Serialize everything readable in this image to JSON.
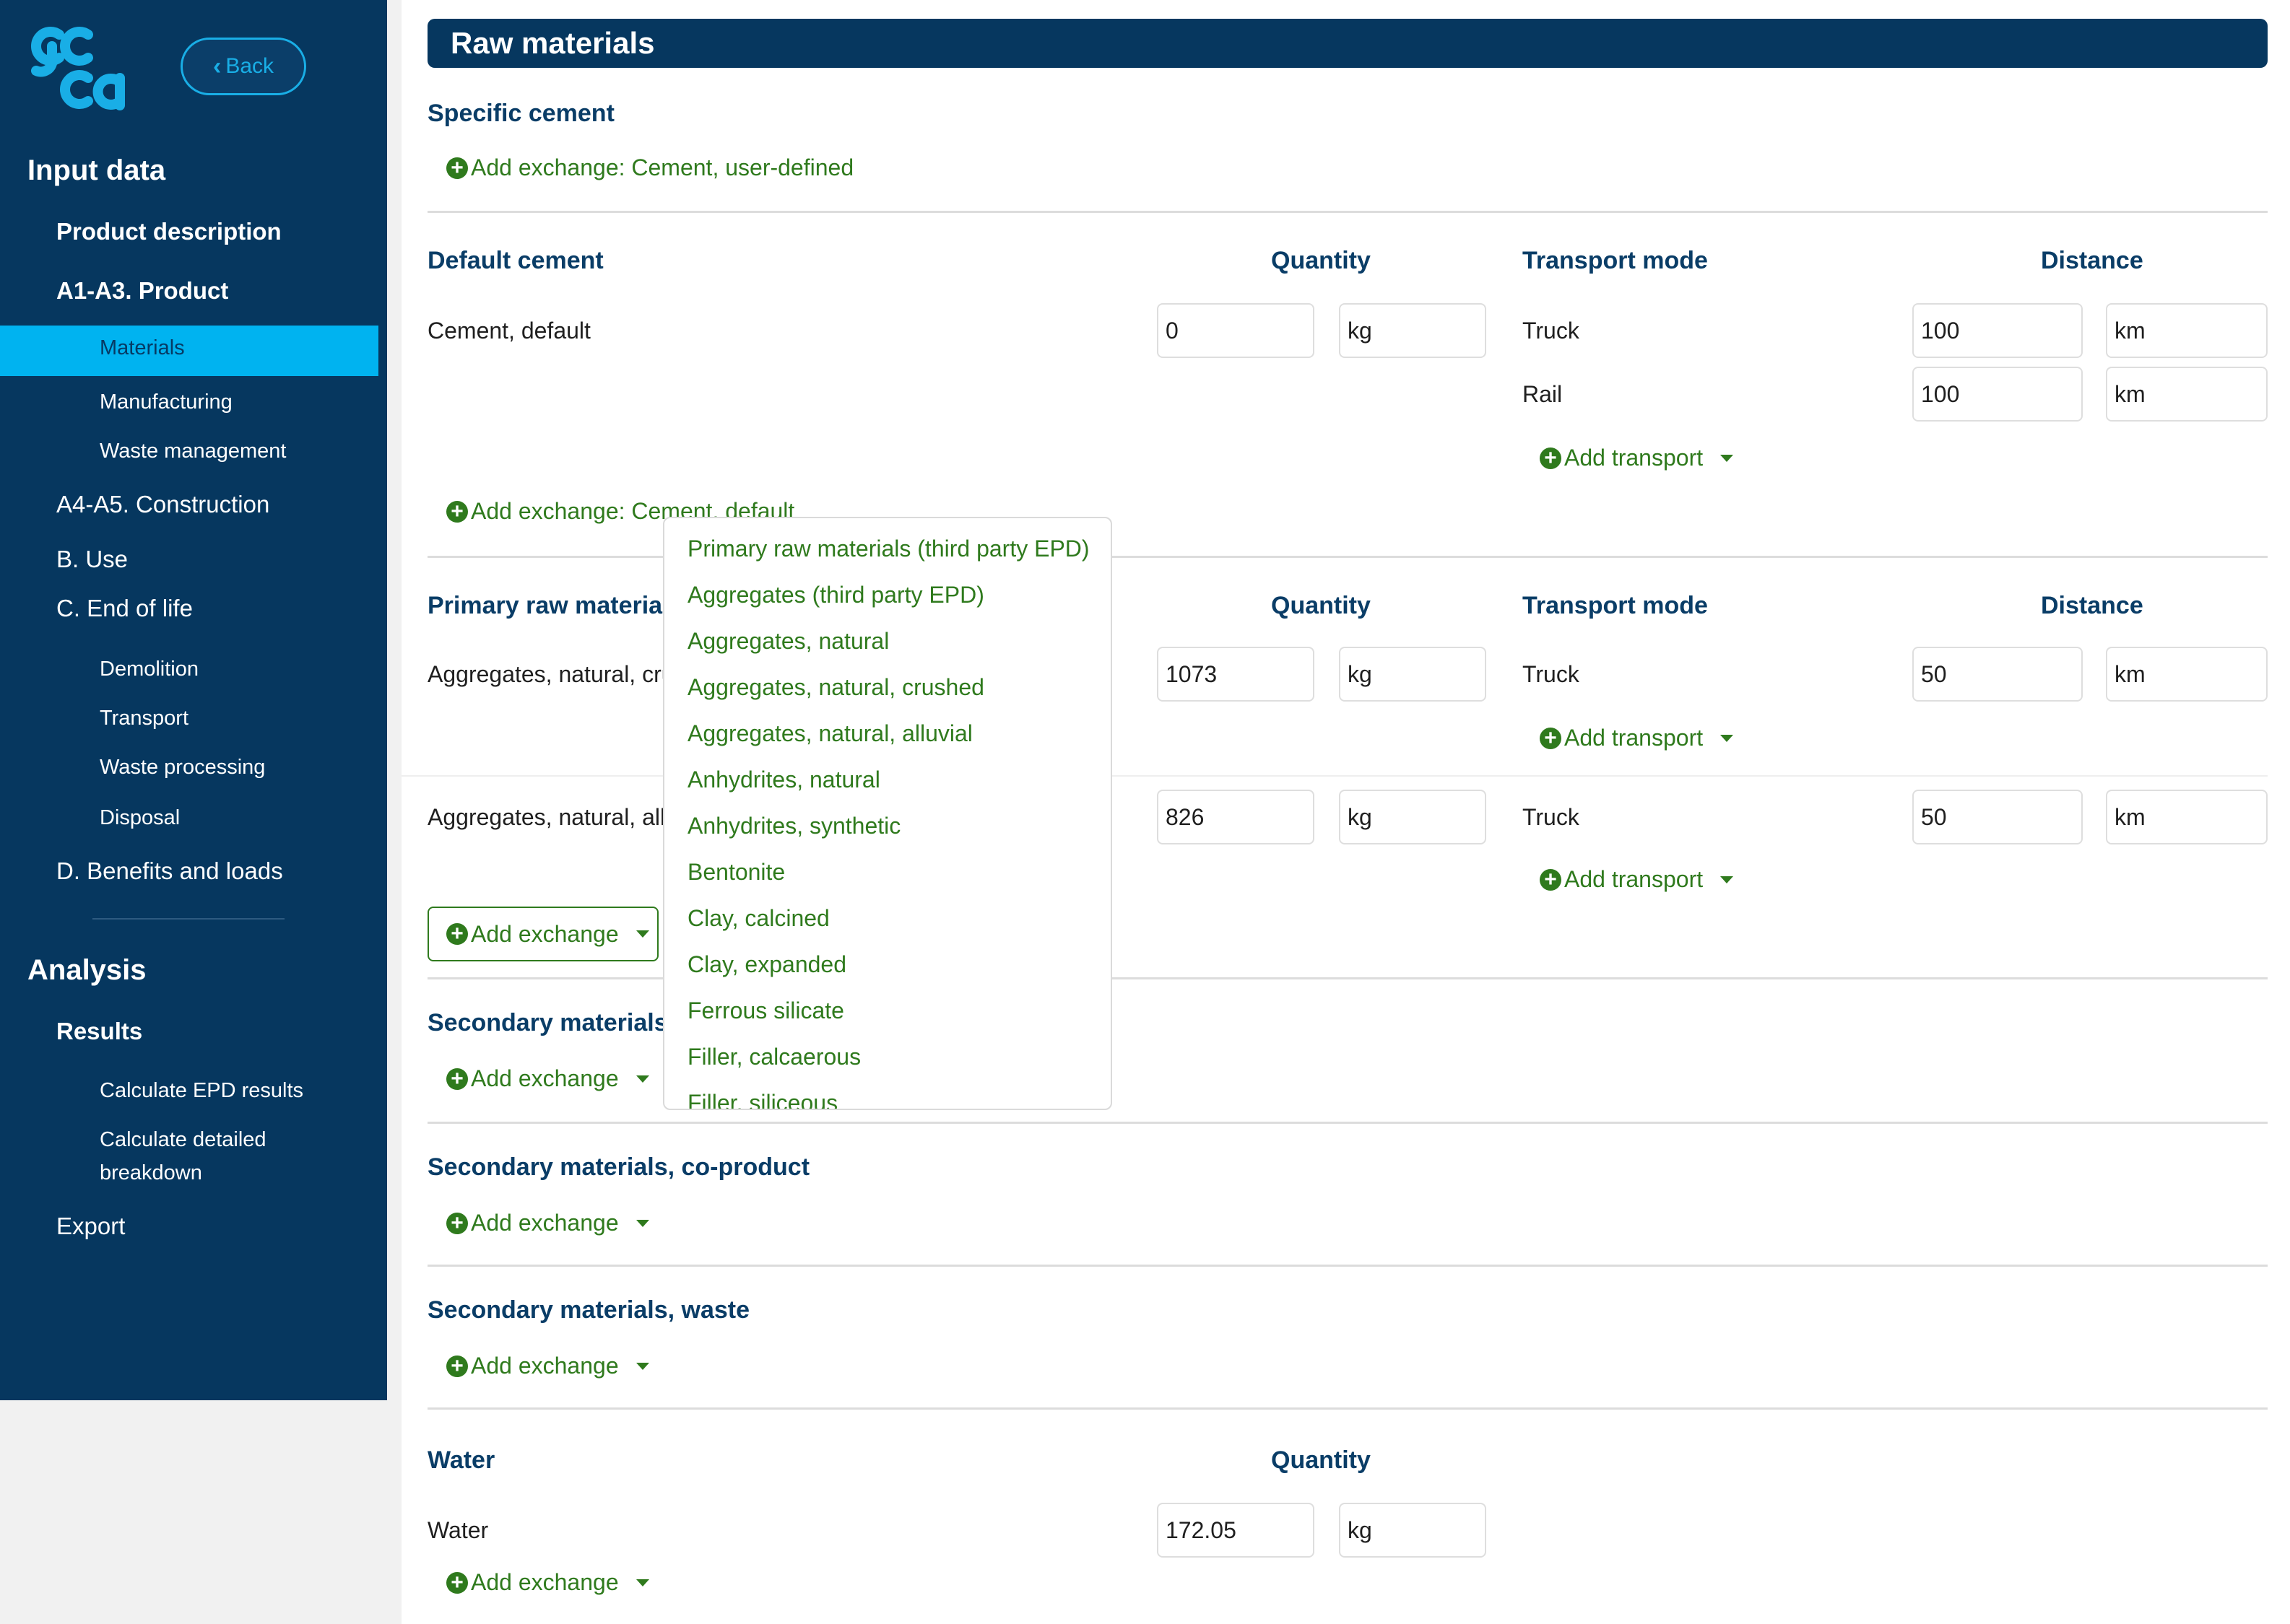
{
  "logo_text": "gcca",
  "back_label": "Back",
  "sidebar": {
    "input_data": "Input data",
    "product_description": "Product description",
    "a1a3": "A1-A3. Product",
    "materials": "Materials",
    "manufacturing": "Manufacturing",
    "waste_management": "Waste management",
    "a4a5": "A4-A5. Construction",
    "b_use": "B. Use",
    "c_end": "C. End of life",
    "demolition": "Demolition",
    "transport": "Transport",
    "waste_processing": "Waste processing",
    "disposal": "Disposal",
    "d_benefits": "D. Benefits and loads",
    "analysis": "Analysis",
    "results": "Results",
    "calc_epd": "Calculate EPD results",
    "calc_detailed_1": "Calculate detailed",
    "calc_detailed_2": "breakdown",
    "export": "Export"
  },
  "page_title": "Raw materials",
  "specific_cement": {
    "title": "Specific cement",
    "add_label": "Add exchange: Cement, user-defined"
  },
  "default_cement": {
    "title": "Default cement",
    "quantity_header": "Quantity",
    "transport_header": "Transport mode",
    "distance_header": "Distance",
    "row_label": "Cement, default",
    "quantity": "0",
    "unit": "kg",
    "transports": [
      {
        "mode": "Truck",
        "distance": "100",
        "unit": "km"
      },
      {
        "mode": "Rail",
        "distance": "100",
        "unit": "km"
      }
    ],
    "add_transport": "Add transport",
    "add_label": "Add exchange: Cement, default"
  },
  "primary_raw": {
    "title": "Primary raw materia",
    "quantity_header": "Quantity",
    "transport_header": "Transport mode",
    "distance_header": "Distance",
    "rows": [
      {
        "label": "Aggregates, natural, cru",
        "quantity": "1073",
        "unit": "kg",
        "mode": "Truck",
        "distance": "50",
        "dunit": "km"
      },
      {
        "label": "Aggregates, natural, all",
        "quantity": "826",
        "unit": "kg",
        "mode": "Truck",
        "distance": "50",
        "dunit": "km"
      }
    ],
    "add_transport": "Add transport",
    "add_exchange": "Add exchange"
  },
  "dropdown_items": [
    "Primary raw materials (third party EPD)",
    "Aggregates (third party EPD)",
    "Aggregates, natural",
    "Aggregates, natural, crushed",
    "Aggregates, natural, alluvial",
    "Anhydrites, natural",
    "Anhydrites, synthetic",
    "Bentonite",
    "Clay, calcined",
    "Clay, expanded",
    "Ferrous silicate",
    "Filler, calcaerous",
    "Filler, siliceous"
  ],
  "secondary_materials": {
    "title": "Secondary materials,",
    "add_exchange": "Add exchange"
  },
  "secondary_coproduct": {
    "title": "Secondary materials, co-product",
    "add_exchange": "Add exchange"
  },
  "secondary_waste": {
    "title": "Secondary materials, waste",
    "add_exchange": "Add exchange"
  },
  "water": {
    "title": "Water",
    "quantity_header": "Quantity",
    "row_label": "Water",
    "quantity": "172.05",
    "unit": "kg",
    "add_exchange": "Add exchange"
  },
  "colors": {
    "sidebar": "#06375f",
    "accent": "#00b3f0",
    "link": "#2f7a1d",
    "heading": "#0a3d67"
  }
}
